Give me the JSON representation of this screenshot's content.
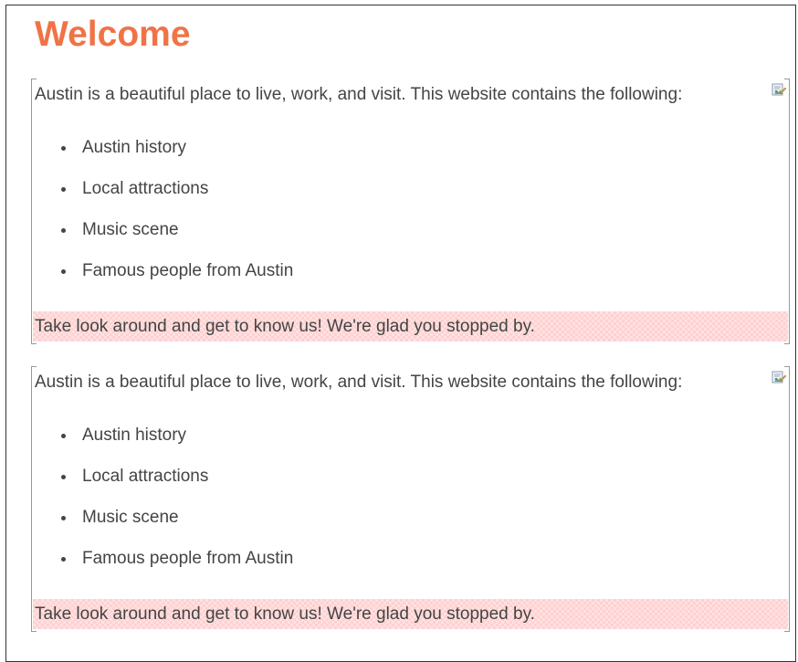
{
  "page": {
    "title": "Welcome",
    "accent_color": "#f07346",
    "highlight_color": "#ffd1d1"
  },
  "blocks": [
    {
      "intro": "Austin is a beautiful place to live, work, and visit. This website contains the following:",
      "icon": "broken-image-icon",
      "items": [
        "Austin history",
        "Local attractions",
        "Music scene",
        "Famous people from Austin"
      ],
      "closing": "Take look around and get to know us! We're glad you stopped by."
    },
    {
      "intro": "Austin is a beautiful place to live, work, and visit. This website contains the following:",
      "icon": "broken-image-icon",
      "items": [
        "Austin history",
        "Local attractions",
        "Music scene",
        "Famous people from Austin"
      ],
      "closing": "Take look around and get to know us! We're glad you stopped by."
    }
  ]
}
